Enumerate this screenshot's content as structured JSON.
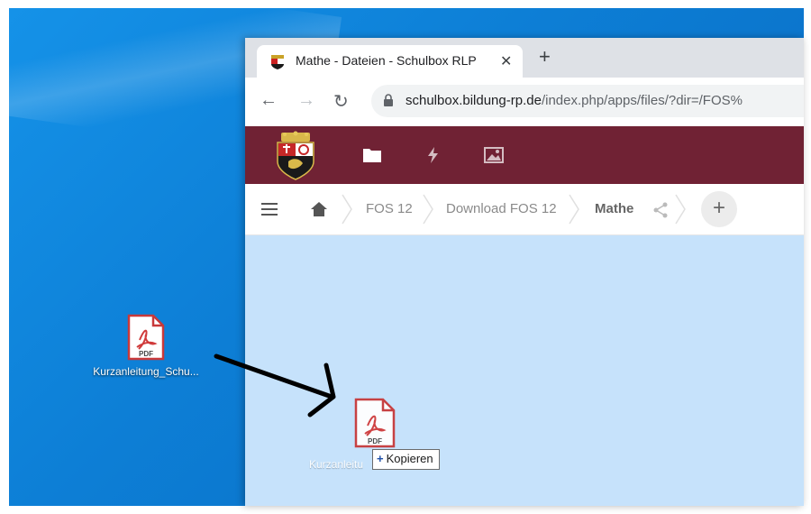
{
  "desktop": {
    "file_icon": {
      "type_label": "PDF",
      "name": "Kurzanleitung_Schu..."
    }
  },
  "browser": {
    "tab": {
      "title": "Mathe - Dateien - Schulbox RLP",
      "close_icon": "close-icon",
      "favicon": "rlp-coat-of-arms"
    },
    "new_tab_icon": "plus-icon",
    "toolbar": {
      "back_icon": "arrow-left-icon",
      "forward_icon": "arrow-right-icon",
      "reload_icon": "reload-icon",
      "url_host": "schulbox.bildung-rp.de",
      "url_path": "/index.php/apps/files/?dir=/FOS%"
    }
  },
  "app": {
    "header_color": "#702234",
    "nav": [
      "folder-icon",
      "activity-icon",
      "photos-icon"
    ],
    "breadcrumbs": [
      "FOS 12",
      "Download FOS 12",
      "Mathe"
    ],
    "add_button": "+"
  },
  "drag": {
    "type_label": "PDF",
    "label": "Kurzanleitu",
    "action": "Kopieren",
    "action_prefix": "+"
  }
}
